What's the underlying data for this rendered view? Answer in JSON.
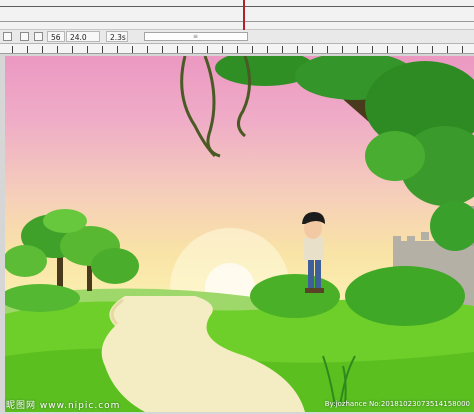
{
  "toolbar": {
    "frame": "56",
    "fps": "24.0 fps",
    "time": "2.3s",
    "scroll_grip": "≡"
  },
  "watermark": {
    "left": "昵图网 www.nipic.com",
    "right": "By:jozhance No:20181023073514158000"
  },
  "colors": {
    "playhead": "#b11f2a",
    "sky_top": "#ec98c2",
    "grass": "#6fcf2a",
    "path": "#f4ecc3"
  },
  "icons": [
    "onion-skin-icon",
    "onion-skin-outline-icon",
    "edit-multiple-frames-icon"
  ]
}
